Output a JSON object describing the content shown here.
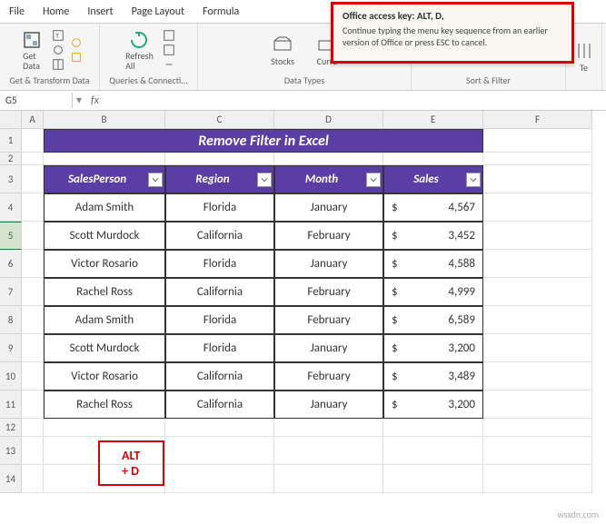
{
  "tabs": {
    "file": "File",
    "home": "Home",
    "insert": "Insert",
    "pagelayout": "Page Layout",
    "formula": "Formula"
  },
  "ribbon": {
    "getdata": "Get\nData",
    "refresh": "Refresh\nAll",
    "stocks": "Stocks",
    "curre": "Curre",
    "group1": "Get & Transform Data",
    "group2": "Queries & Connecti...",
    "group3": "Data Types",
    "group4": "Sort & Filter",
    "te": "Te"
  },
  "tooltip": {
    "title": "Office access key: ALT, D,",
    "body": "Continue typing the menu key sequence from an earlier version of Office or press ESC to cancel."
  },
  "namebox": "G5",
  "cols": [
    "A",
    "B",
    "C",
    "D",
    "E",
    "F"
  ],
  "rows": [
    "1",
    "2",
    "3",
    "4",
    "5",
    "6",
    "7",
    "8",
    "9",
    "10",
    "11",
    "12",
    "13",
    "14"
  ],
  "title": "Remove Filter in Excel",
  "headers": {
    "c1": "SalesPerson",
    "c2": "Region",
    "c3": "Month",
    "c4": "Sales"
  },
  "chart_data": {
    "type": "table",
    "columns": [
      "SalesPerson",
      "Region",
      "Month",
      "Sales"
    ],
    "rows": [
      [
        "Adam Smith",
        "Florida",
        "January",
        4567
      ],
      [
        "Scott Murdock",
        "California",
        "February",
        3452
      ],
      [
        "Victor Rosario",
        "Florida",
        "January",
        4588
      ],
      [
        "Rachel Ross",
        "California",
        "February",
        4999
      ],
      [
        "Adam Smith",
        "Florida",
        "February",
        6589
      ],
      [
        "Scott Murdock",
        "Florida",
        "January",
        3200
      ],
      [
        "Victor Rosario",
        "California",
        "February",
        3489
      ],
      [
        "Rachel Ross",
        "California",
        "January",
        3200
      ]
    ]
  },
  "data": [
    {
      "p": "Adam Smith",
      "r": "Florida",
      "m": "January",
      "s": "4,567"
    },
    {
      "p": "Scott Murdock",
      "r": "California",
      "m": "February",
      "s": "3,452"
    },
    {
      "p": "Victor Rosario",
      "r": "Florida",
      "m": "January",
      "s": "4,588"
    },
    {
      "p": "Rachel Ross",
      "r": "California",
      "m": "February",
      "s": "4,999"
    },
    {
      "p": "Adam Smith",
      "r": "Florida",
      "m": "February",
      "s": "6,589"
    },
    {
      "p": "Scott Murdock",
      "r": "Florida",
      "m": "January",
      "s": "3,200"
    },
    {
      "p": "Victor Rosario",
      "r": "California",
      "m": "February",
      "s": "3,489"
    },
    {
      "p": "Rachel Ross",
      "r": "California",
      "m": "January",
      "s": "3,200"
    }
  ],
  "currency": "$",
  "shortcut": "ALT + D",
  "watermark": "wsxdn.com"
}
